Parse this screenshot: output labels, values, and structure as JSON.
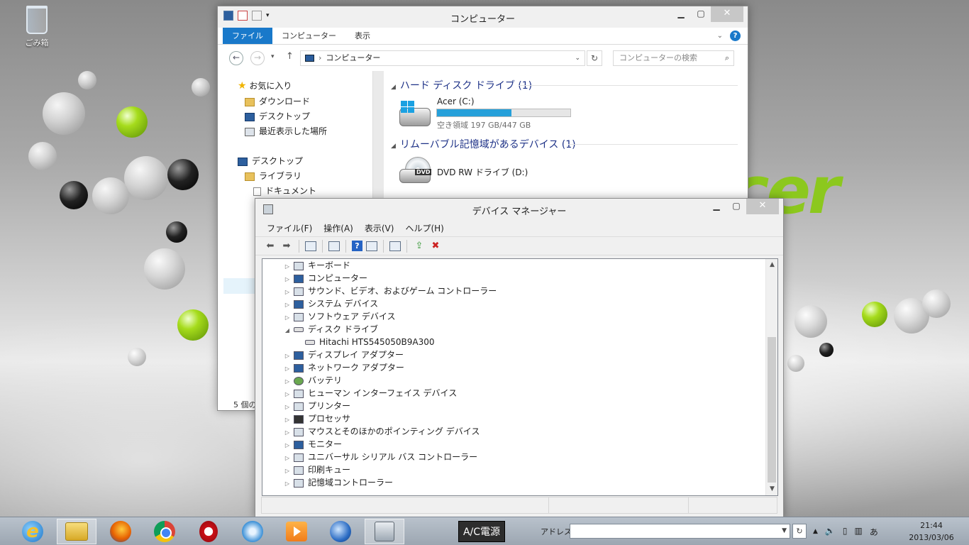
{
  "desktop": {
    "recycle_bin_label": "ごみ箱",
    "brand_logo_text": "cer",
    "accent_green": "#8cc81e"
  },
  "explorer": {
    "title": "コンピューター",
    "ribbon_tabs": [
      "ファイル",
      "コンピューター",
      "表示"
    ],
    "address_path": "コンピューター",
    "search_placeholder": "コンピューターの検索",
    "nav": {
      "favorites": "お気に入り",
      "downloads": "ダウンロード",
      "desktop_fav": "デスクトップ",
      "recent": "最近表示した場所",
      "desktop": "デスクトップ",
      "libraries": "ライブラリ",
      "documents": "ドキュメント"
    },
    "groups": {
      "hdd": "ハード ディスク ドライブ (1)",
      "removable": "リムーバブル記憶域があるデバイス (1)"
    },
    "drives": [
      {
        "name": "Acer (C:)",
        "free_text": "空き領域 197 GB/447 GB",
        "used_fraction": 0.56
      },
      {
        "name": "DVD RW ドライブ (D:)",
        "badge": "DVD"
      }
    ],
    "status_text": "5 個の"
  },
  "devmgr": {
    "title": "デバイス マネージャー",
    "menus": [
      "ファイル(F)",
      "操作(A)",
      "表示(V)",
      "ヘルプ(H)"
    ],
    "tree": [
      {
        "label": "キーボード",
        "expanded": false,
        "icon": "keyboard-icon"
      },
      {
        "label": "コンピューター",
        "expanded": false,
        "icon": "computer-icon"
      },
      {
        "label": "サウンド、ビデオ、およびゲーム コントローラー",
        "expanded": false,
        "icon": "speaker-icon"
      },
      {
        "label": "システム デバイス",
        "expanded": false,
        "icon": "system-device-icon"
      },
      {
        "label": "ソフトウェア デバイス",
        "expanded": false,
        "icon": "software-device-icon"
      },
      {
        "label": "ディスク ドライブ",
        "expanded": true,
        "icon": "disk-drive-icon"
      },
      {
        "label": "Hitachi HTS545050B9A300",
        "child": true,
        "icon": "hard-disk-icon"
      },
      {
        "label": "ディスプレイ アダプター",
        "expanded": false,
        "icon": "display-adapter-icon"
      },
      {
        "label": "ネットワーク アダプター",
        "expanded": false,
        "icon": "network-adapter-icon"
      },
      {
        "label": "バッテリ",
        "expanded": false,
        "icon": "battery-icon"
      },
      {
        "label": "ヒューマン インターフェイス デバイス",
        "expanded": false,
        "icon": "hid-icon"
      },
      {
        "label": "プリンター",
        "expanded": false,
        "icon": "printer-icon"
      },
      {
        "label": "プロセッサ",
        "expanded": false,
        "icon": "processor-icon"
      },
      {
        "label": "マウスとそのほかのポインティング デバイス",
        "expanded": false,
        "icon": "mouse-icon"
      },
      {
        "label": "モニター",
        "expanded": false,
        "icon": "monitor-icon"
      },
      {
        "label": "ユニバーサル シリアル バス コントローラー",
        "expanded": false,
        "icon": "usb-icon"
      },
      {
        "label": "印刷キュー",
        "expanded": false,
        "icon": "print-queue-icon"
      },
      {
        "label": "記憶域コントローラー",
        "expanded": false,
        "icon": "storage-controller-icon"
      }
    ]
  },
  "taskbar": {
    "ac_power_label": "A/C電源",
    "address_label": "アドレス",
    "address_value": "",
    "ime_label": "あ",
    "time": "21:44",
    "date": "2013/03/06"
  }
}
